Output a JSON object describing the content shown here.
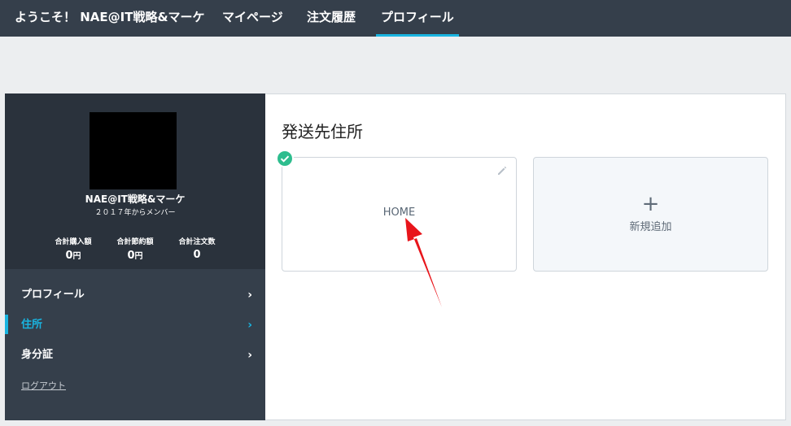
{
  "nav": {
    "welcome": "ようこそ！ NAE@IT戦略&マーケ",
    "mypage": "マイページ",
    "orders": "注文履歴",
    "profile": "プロフィール"
  },
  "user": {
    "name": "NAE@IT戦略&マーケ",
    "member_since": "２０１７年からメンバー",
    "stats": [
      {
        "label": "合計購入額",
        "value": "0",
        "unit": "円"
      },
      {
        "label": "合計節約額",
        "value": "0",
        "unit": "円"
      },
      {
        "label": "合計注文数",
        "value": "0",
        "unit": ""
      }
    ]
  },
  "menu": {
    "items": [
      {
        "label": "プロフィール",
        "chevron": "›"
      },
      {
        "label": "住所",
        "chevron": "›"
      },
      {
        "label": "身分証",
        "chevron": "›"
      }
    ],
    "logout": "ログアウト"
  },
  "main": {
    "title": "発送先住所",
    "addresses": [
      {
        "name": "HOME"
      }
    ],
    "add_label": "新規追加",
    "add_symbol": "+"
  },
  "colors": {
    "accent": "#19b4e0",
    "selected_check": "#2ebd8e",
    "annotation_arrow": "#e8151b"
  }
}
